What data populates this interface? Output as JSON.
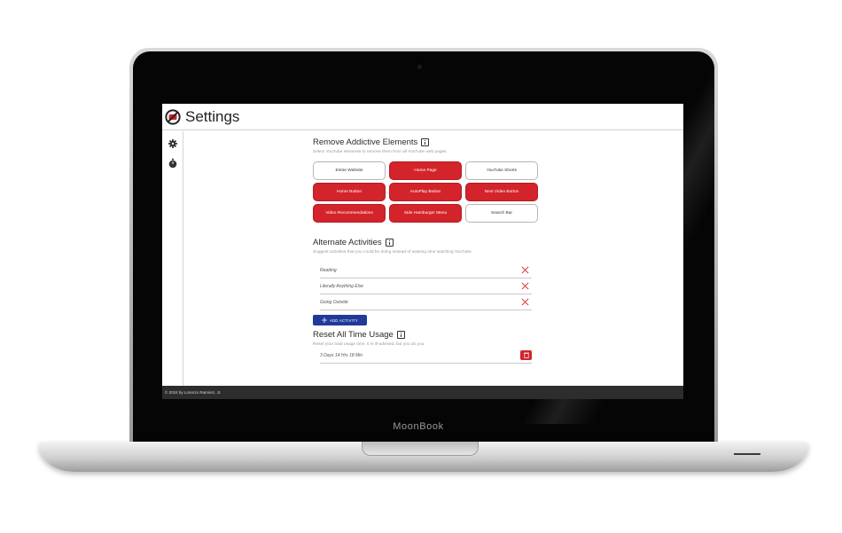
{
  "device": {
    "brand": "MoonBook"
  },
  "header": {
    "title": "Settings"
  },
  "sidebar": {
    "items": [
      {
        "icon": "gear-icon"
      },
      {
        "icon": "stopwatch-icon"
      }
    ]
  },
  "remove": {
    "title": "Remove Addictive Elements",
    "subtitle": "Select YouTube elements to remove them from all YouTube web pages",
    "buttons": [
      {
        "label": "Entire Website",
        "active": false
      },
      {
        "label": "Home Page",
        "active": true
      },
      {
        "label": "YouTube Shorts",
        "active": false
      },
      {
        "label": "Home Button",
        "active": true
      },
      {
        "label": "AutoPlay Button",
        "active": true
      },
      {
        "label": "Next Video Button",
        "active": true
      },
      {
        "label": "Video Recommendations",
        "active": true
      },
      {
        "label": "Side Hamburger Menu",
        "active": true
      },
      {
        "label": "Search Bar",
        "active": false
      }
    ]
  },
  "alternate": {
    "title": "Alternate Activities",
    "subtitle": "Suggest activities that you could be doing instead of wasting time watching YouTube",
    "activities": [
      "Reading",
      "Literally Anything Else",
      "Going Outside"
    ],
    "add_label": "ADD ACTIVITY"
  },
  "reset": {
    "title": "Reset All Time Usage",
    "subtitle": "Reset your total usage time. It is ill-advised, but you do you.",
    "usage": "3 Days 14 Hrs 18 Min"
  },
  "footer": {
    "text": "© 2024 by Lorenzo Ramirez, Jr."
  },
  "colors": {
    "accent_red": "#d3242b",
    "accent_blue": "#1f3a9a"
  }
}
